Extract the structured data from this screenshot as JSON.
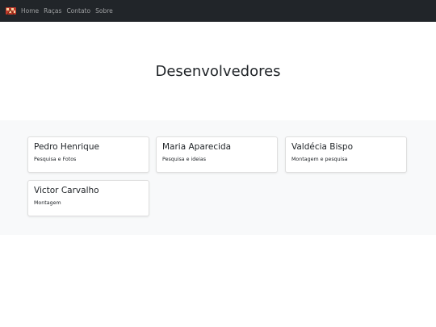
{
  "navbar": {
    "brand_icon": "racing-flag-logo-icon",
    "links": [
      "Home",
      "Raças",
      "Contato",
      "Sobre"
    ]
  },
  "hero": {
    "title": "Desenvolvedores"
  },
  "developers": [
    {
      "name": "Pedro Henrique",
      "role": "Pesquisa e Fotos"
    },
    {
      "name": "Maria Aparecida",
      "role": "Pesquisa e ideias"
    },
    {
      "name": "Valdécia Bispo",
      "role": "Montagem e pesquisa"
    },
    {
      "name": "Victor Carvalho",
      "role": "Montagem"
    }
  ],
  "colors": {
    "navbar_bg": "#212529",
    "album_bg": "#f8f9fa"
  }
}
